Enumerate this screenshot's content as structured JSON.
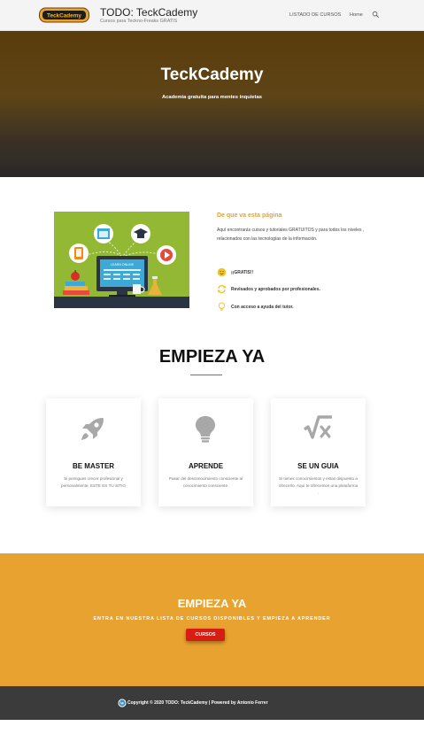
{
  "header": {
    "logo_text": "TeckCademy",
    "title": "TODO: TeckCademy",
    "tagline": "Cursos para Teckno-Freaks GRATIS",
    "nav": {
      "courses": "LISTADO DE CURSOS",
      "home": "Home"
    },
    "search_icon": "search-icon"
  },
  "hero": {
    "title": "TeckCademy",
    "subtitle": "Academia gratuita para mentes inquietas"
  },
  "about": {
    "illustration_label": "LEARN ONLINE",
    "heading": "De que va esta página",
    "text": "Aquí encontrarás cursos y tutoriales  GRATUITOS y para todos los niveles , relacionados con las tecnologías de la información.",
    "features": [
      {
        "icon": "smile-icon",
        "label": "¡¡GRATIS!!"
      },
      {
        "icon": "refresh-icon",
        "label": "Revisados y aprobados por profesionales."
      },
      {
        "icon": "lightbulb-icon",
        "label": "Con acceso a ayuda del tutor."
      }
    ]
  },
  "start": {
    "title": "EMPIEZA YA",
    "cards": [
      {
        "icon": "rocket-icon",
        "title": "BE MASTER",
        "text": "Si persigues crecer profesional y personalmente, ESTE ES TU SITIO"
      },
      {
        "icon": "lightbulb-icon",
        "title": "APRENDE",
        "text": "Pasar del desconocimiento consciente al conocimiento consciente."
      },
      {
        "icon": "square-root-icon",
        "title": "SE UN GUIA",
        "text": "Si tienes conocimientos y estas dispuesto a ofrecerlo. Aquí te ofrecemos una plataforma ."
      }
    ]
  },
  "cta": {
    "title": "EMPIEZA YA",
    "text": "ENTRA EN NUESTRA LISTA DE CURSOS DISPONIBLES Y EMPIEZA A APRENDER",
    "button": "CURSOS"
  },
  "footer": {
    "icon": "wordpress-icon",
    "text": "Copyright © 2020 TODO: TeckCademy | Powered by Antonio Ferrer"
  },
  "colors": {
    "accent": "#e8a230",
    "button": "#d81d12",
    "footer": "#3b3b3b",
    "divider": "#2d83c5"
  }
}
